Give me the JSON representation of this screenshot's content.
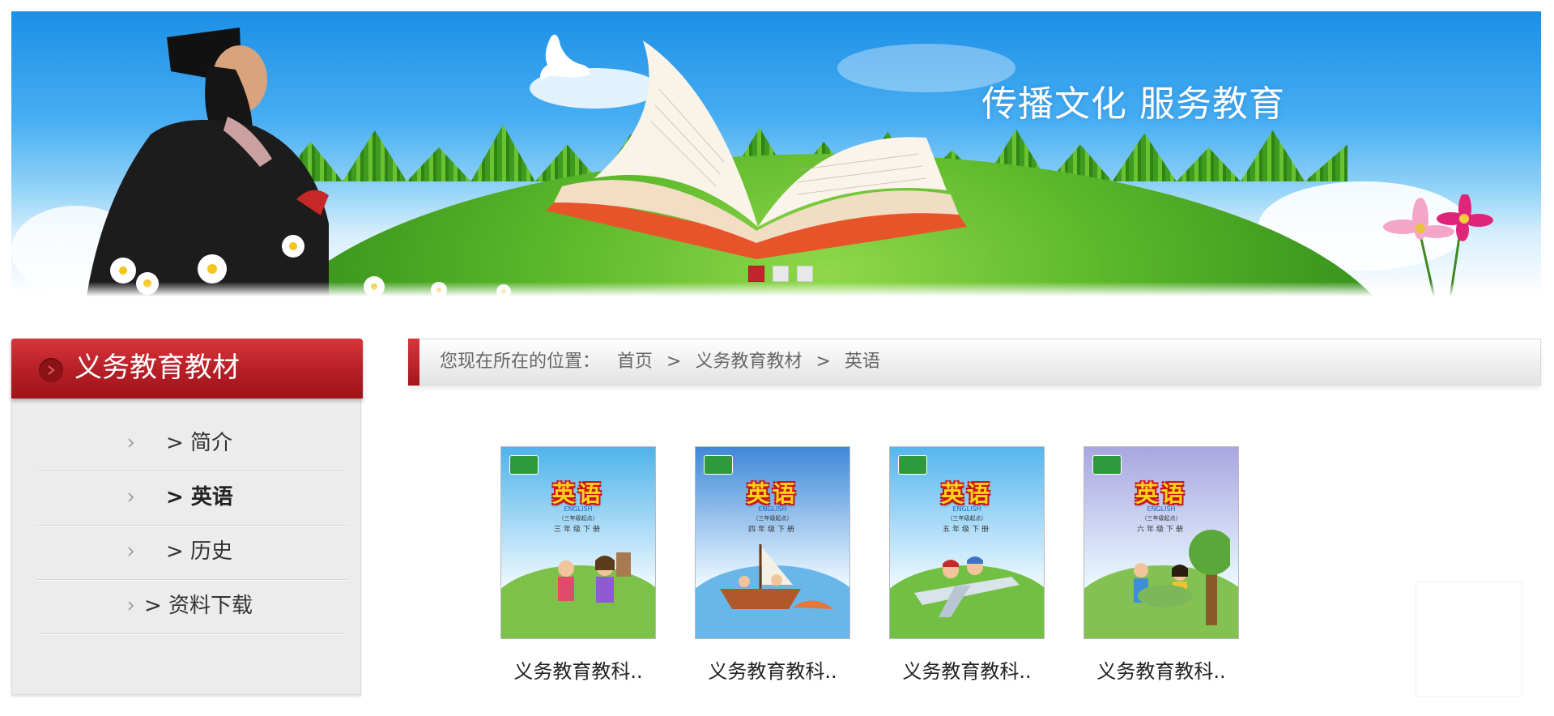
{
  "banner": {
    "slogan": "传播文化 服务教育",
    "slide_count": 3,
    "active_slide": 1
  },
  "sidebar": {
    "title": "义务教育教材",
    "items": [
      {
        "label": "> 简介",
        "active": false
      },
      {
        "label": "> 英语",
        "active": true
      },
      {
        "label": "> 历史",
        "active": false
      },
      {
        "label": "> 资料下载",
        "active": false
      }
    ]
  },
  "breadcrumb": {
    "prefix": "您现在所在的位置：",
    "home": "首页",
    "separator": ">",
    "category": "义务教育教材",
    "current": "英语"
  },
  "books": [
    {
      "title_cn": "英语",
      "title_en": "ENGLISH",
      "edition": "（三年级起点）",
      "grade": "三年级下册",
      "caption": "义务教育教科..",
      "sky": "#4fb3ea",
      "ground": "#7cc24a"
    },
    {
      "title_cn": "英语",
      "title_en": "ENGLISH",
      "edition": "（三年级起点）",
      "grade": "四年级下册",
      "caption": "义务教育教科..",
      "sky": "#3f88d8",
      "ground": "#69b6e8"
    },
    {
      "title_cn": "英语",
      "title_en": "ENGLISH",
      "edition": "（三年级起点）",
      "grade": "五年级下册",
      "caption": "义务教育教科..",
      "sky": "#55b6ee",
      "ground": "#72c043"
    },
    {
      "title_cn": "英语",
      "title_en": "ENGLISH",
      "edition": "（三年级起点）",
      "grade": "六年级下册",
      "caption": "义务教育教科..",
      "sky": "#a9a6e0",
      "ground": "#83c252"
    }
  ],
  "colors": {
    "accent_red": "#b51e25",
    "sidebar_bg": "#ececec",
    "text": "#333333"
  }
}
